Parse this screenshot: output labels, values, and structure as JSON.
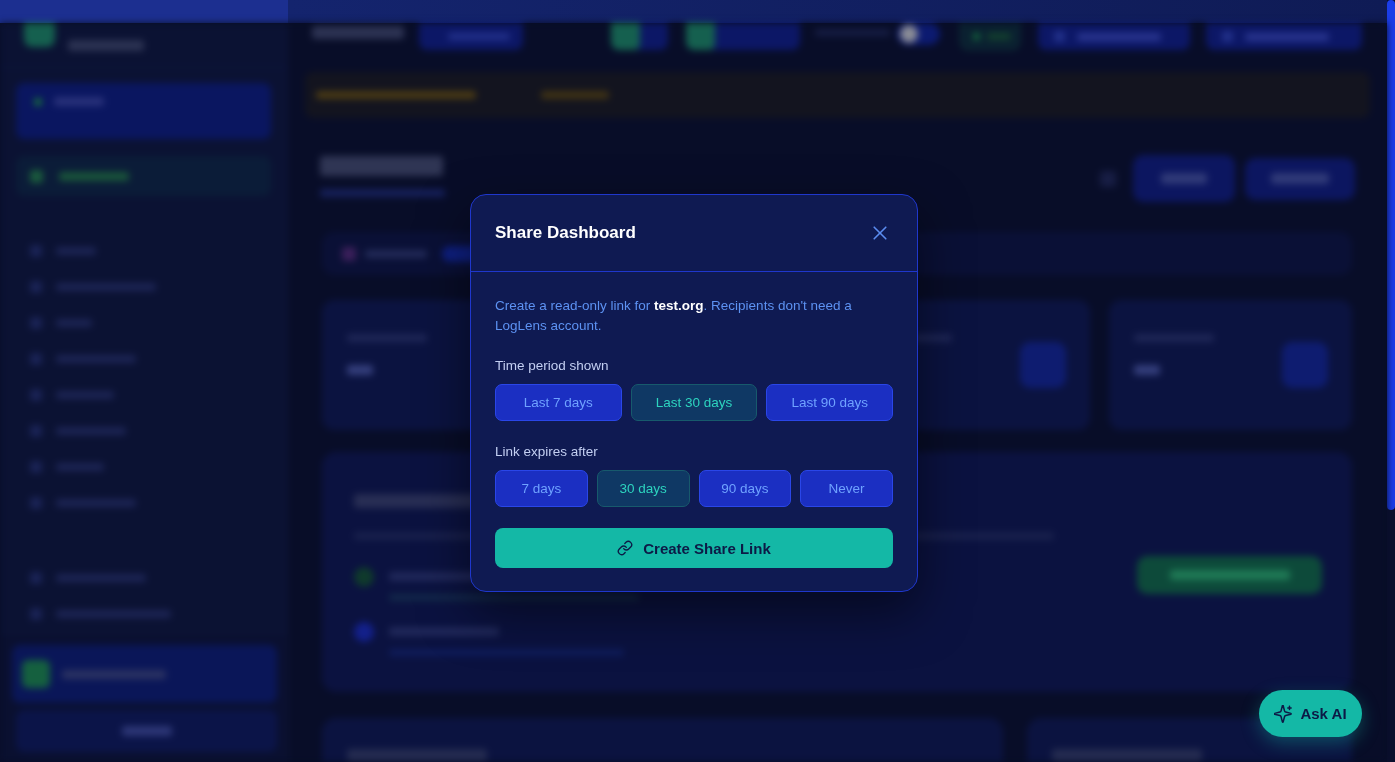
{
  "header_toggle": {
    "on": false
  },
  "share_dialog": {
    "title": "Share Dashboard",
    "description": "Create a read-only link for **test.org**. Recipients don't need a LogLens account.",
    "groups": [
      {
        "label": "Time period shown",
        "options": [
          {
            "label": "Last 7 days",
            "selected": false
          },
          {
            "label": "Last 30 days",
            "selected": true
          },
          {
            "label": "Last 90 days",
            "selected": false
          }
        ]
      },
      {
        "label": "Link expires after",
        "options": [
          {
            "label": "7 days",
            "selected": false
          },
          {
            "label": "30 days",
            "selected": true
          },
          {
            "label": "90 days",
            "selected": false
          },
          {
            "label": "Never",
            "selected": false
          }
        ]
      }
    ],
    "primary_button": {
      "label": "Create Share Link"
    }
  },
  "assistant_button": {
    "label": "Ask AI"
  }
}
